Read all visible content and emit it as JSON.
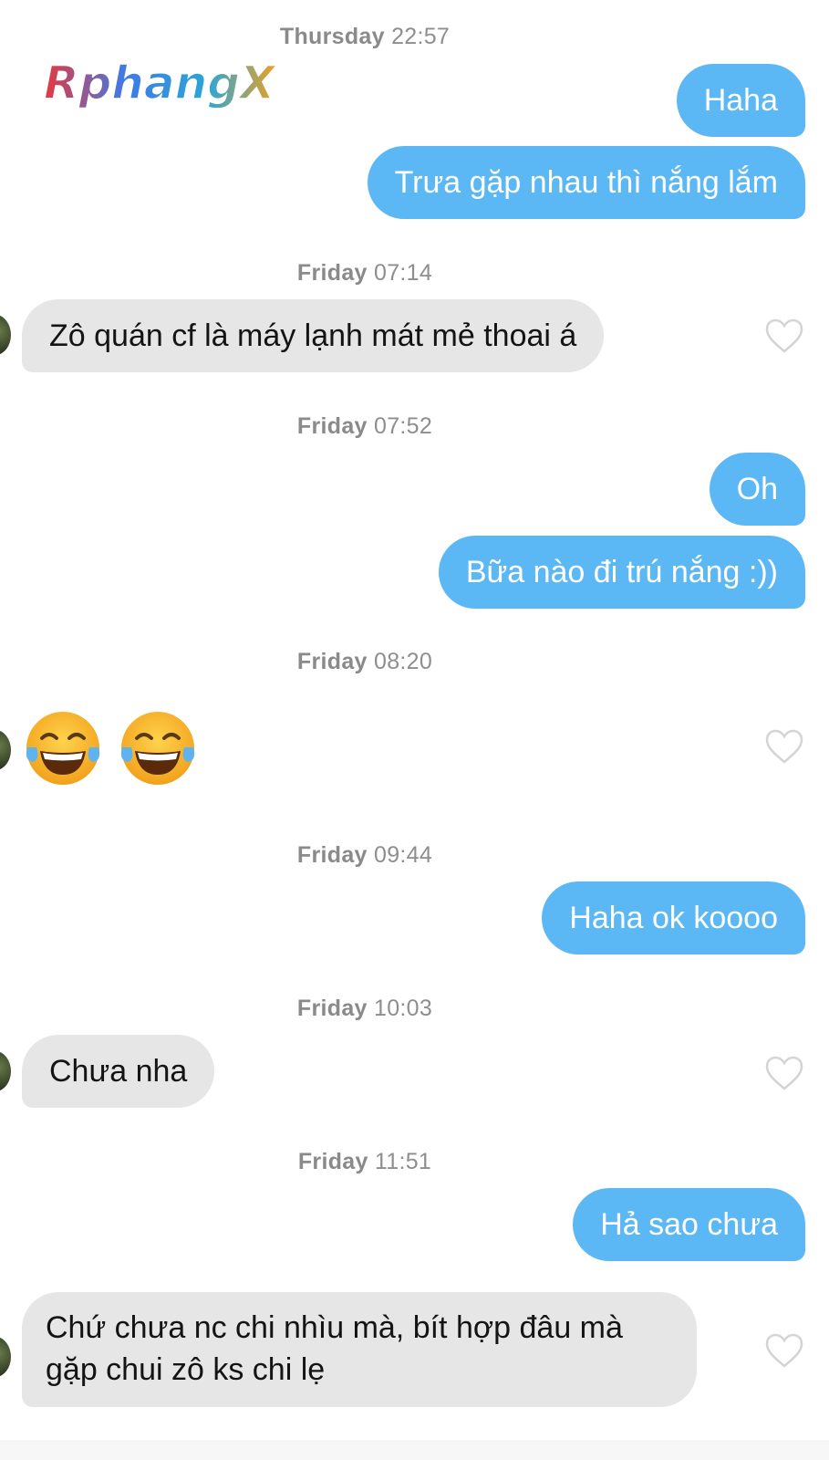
{
  "logo": {
    "text": "RphangX"
  },
  "colors": {
    "outgoing": "#5cb8f5",
    "incoming": "#e6e6e6",
    "timestamp": "#8e8e8e"
  },
  "thread": [
    {
      "type": "timestamp",
      "day": "Thursday",
      "time": "22:57"
    },
    {
      "type": "outgoing",
      "text": "Haha"
    },
    {
      "type": "outgoing",
      "text": "Trưa gặp nhau thì nắng lắm"
    },
    {
      "type": "timestamp",
      "day": "Friday",
      "time": "07:14"
    },
    {
      "type": "incoming",
      "text": "Zô quán cf là máy lạnh mát mẻ thoai á"
    },
    {
      "type": "timestamp",
      "day": "Friday",
      "time": "07:52"
    },
    {
      "type": "outgoing",
      "text": "Oh"
    },
    {
      "type": "outgoing",
      "text": "Bữa nào đi trú nắng :))"
    },
    {
      "type": "timestamp",
      "day": "Friday",
      "time": "08:20"
    },
    {
      "type": "incoming",
      "text": "😂😂",
      "emoji": "face-with-tears-of-joy"
    },
    {
      "type": "timestamp",
      "day": "Friday",
      "time": "09:44"
    },
    {
      "type": "outgoing",
      "text": "Haha ok koooo"
    },
    {
      "type": "timestamp",
      "day": "Friday",
      "time": "10:03"
    },
    {
      "type": "incoming",
      "text": "Chưa nha"
    },
    {
      "type": "timestamp",
      "day": "Friday",
      "time": "11:51"
    },
    {
      "type": "outgoing",
      "text": "Hả sao chưa"
    },
    {
      "type": "incoming",
      "text": "Chứ chưa nc chi nhìu mà, bít hợp đâu mà gặp chui zô ks chi lẹ"
    }
  ]
}
